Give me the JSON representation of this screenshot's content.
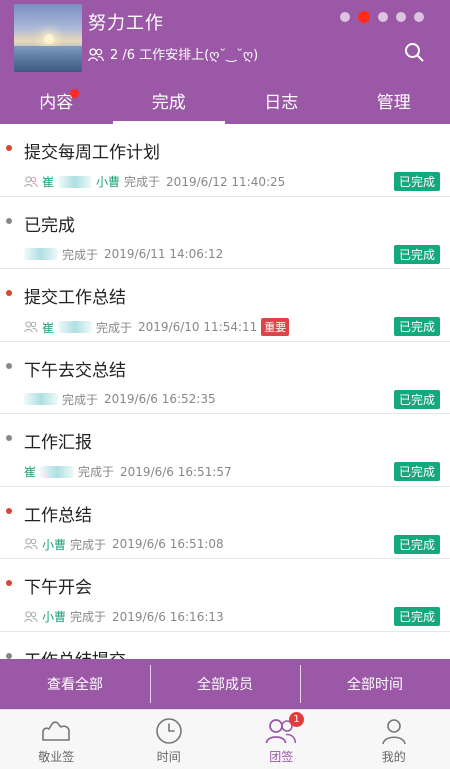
{
  "header": {
    "title": "努力工作",
    "subtitle": "2 /6 工作安排上(ღ˘‿˘ღ)",
    "page_dots": 5,
    "active_dot": 1
  },
  "tabs": [
    {
      "label": "内容",
      "has_dot": true
    },
    {
      "label": "完成",
      "active": true
    },
    {
      "label": "日志"
    },
    {
      "label": "管理"
    }
  ],
  "items": [
    {
      "title": "提交每周工作计划",
      "who": "崔",
      "who2": "小曹",
      "label": "完成于",
      "time": "2019/6/12 11:40:25",
      "status": "已完成",
      "bullet": "red"
    },
    {
      "title": "已完成",
      "label": "完成于",
      "time": "2019/6/11 14:06:12",
      "status": "已完成",
      "bullet": "gray"
    },
    {
      "title": "提交工作总结",
      "who": "崔",
      "label": "完成于",
      "time": "2019/6/10 11:54:11",
      "tag": "重要",
      "status": "已完成",
      "bullet": "red"
    },
    {
      "title": "下午去交总结",
      "label": "完成于",
      "time": "2019/6/6 16:52:35",
      "status": "已完成",
      "bullet": "gray"
    },
    {
      "title": "工作汇报",
      "who": "崔",
      "label": "完成于",
      "time": "2019/6/6 16:51:57",
      "status": "已完成",
      "bullet": "gray"
    },
    {
      "title": "工作总结",
      "who": "小曹",
      "label": "完成于",
      "time": "2019/6/6 16:51:08",
      "status": "已完成",
      "bullet": "red"
    },
    {
      "title": "下午开会",
      "who": "小曹",
      "label": "完成于",
      "time": "2019/6/6 16:16:13",
      "status": "已完成",
      "bullet": "red"
    },
    {
      "title": "工作总结提交",
      "bullet": "gray"
    }
  ],
  "filters": [
    "查看全部",
    "全部成员",
    "全部时间"
  ],
  "nav": [
    {
      "label": "敬业签",
      "icon": "cloud-icon"
    },
    {
      "label": "时间",
      "icon": "clock-icon"
    },
    {
      "label": "团签",
      "icon": "team-icon",
      "active": true,
      "badge": "1"
    },
    {
      "label": "我的",
      "icon": "person-icon"
    }
  ],
  "colors": {
    "primary": "#9b58a6",
    "done": "#14a87f",
    "important": "#e04347",
    "accent_dot": "#ff2b1c"
  }
}
